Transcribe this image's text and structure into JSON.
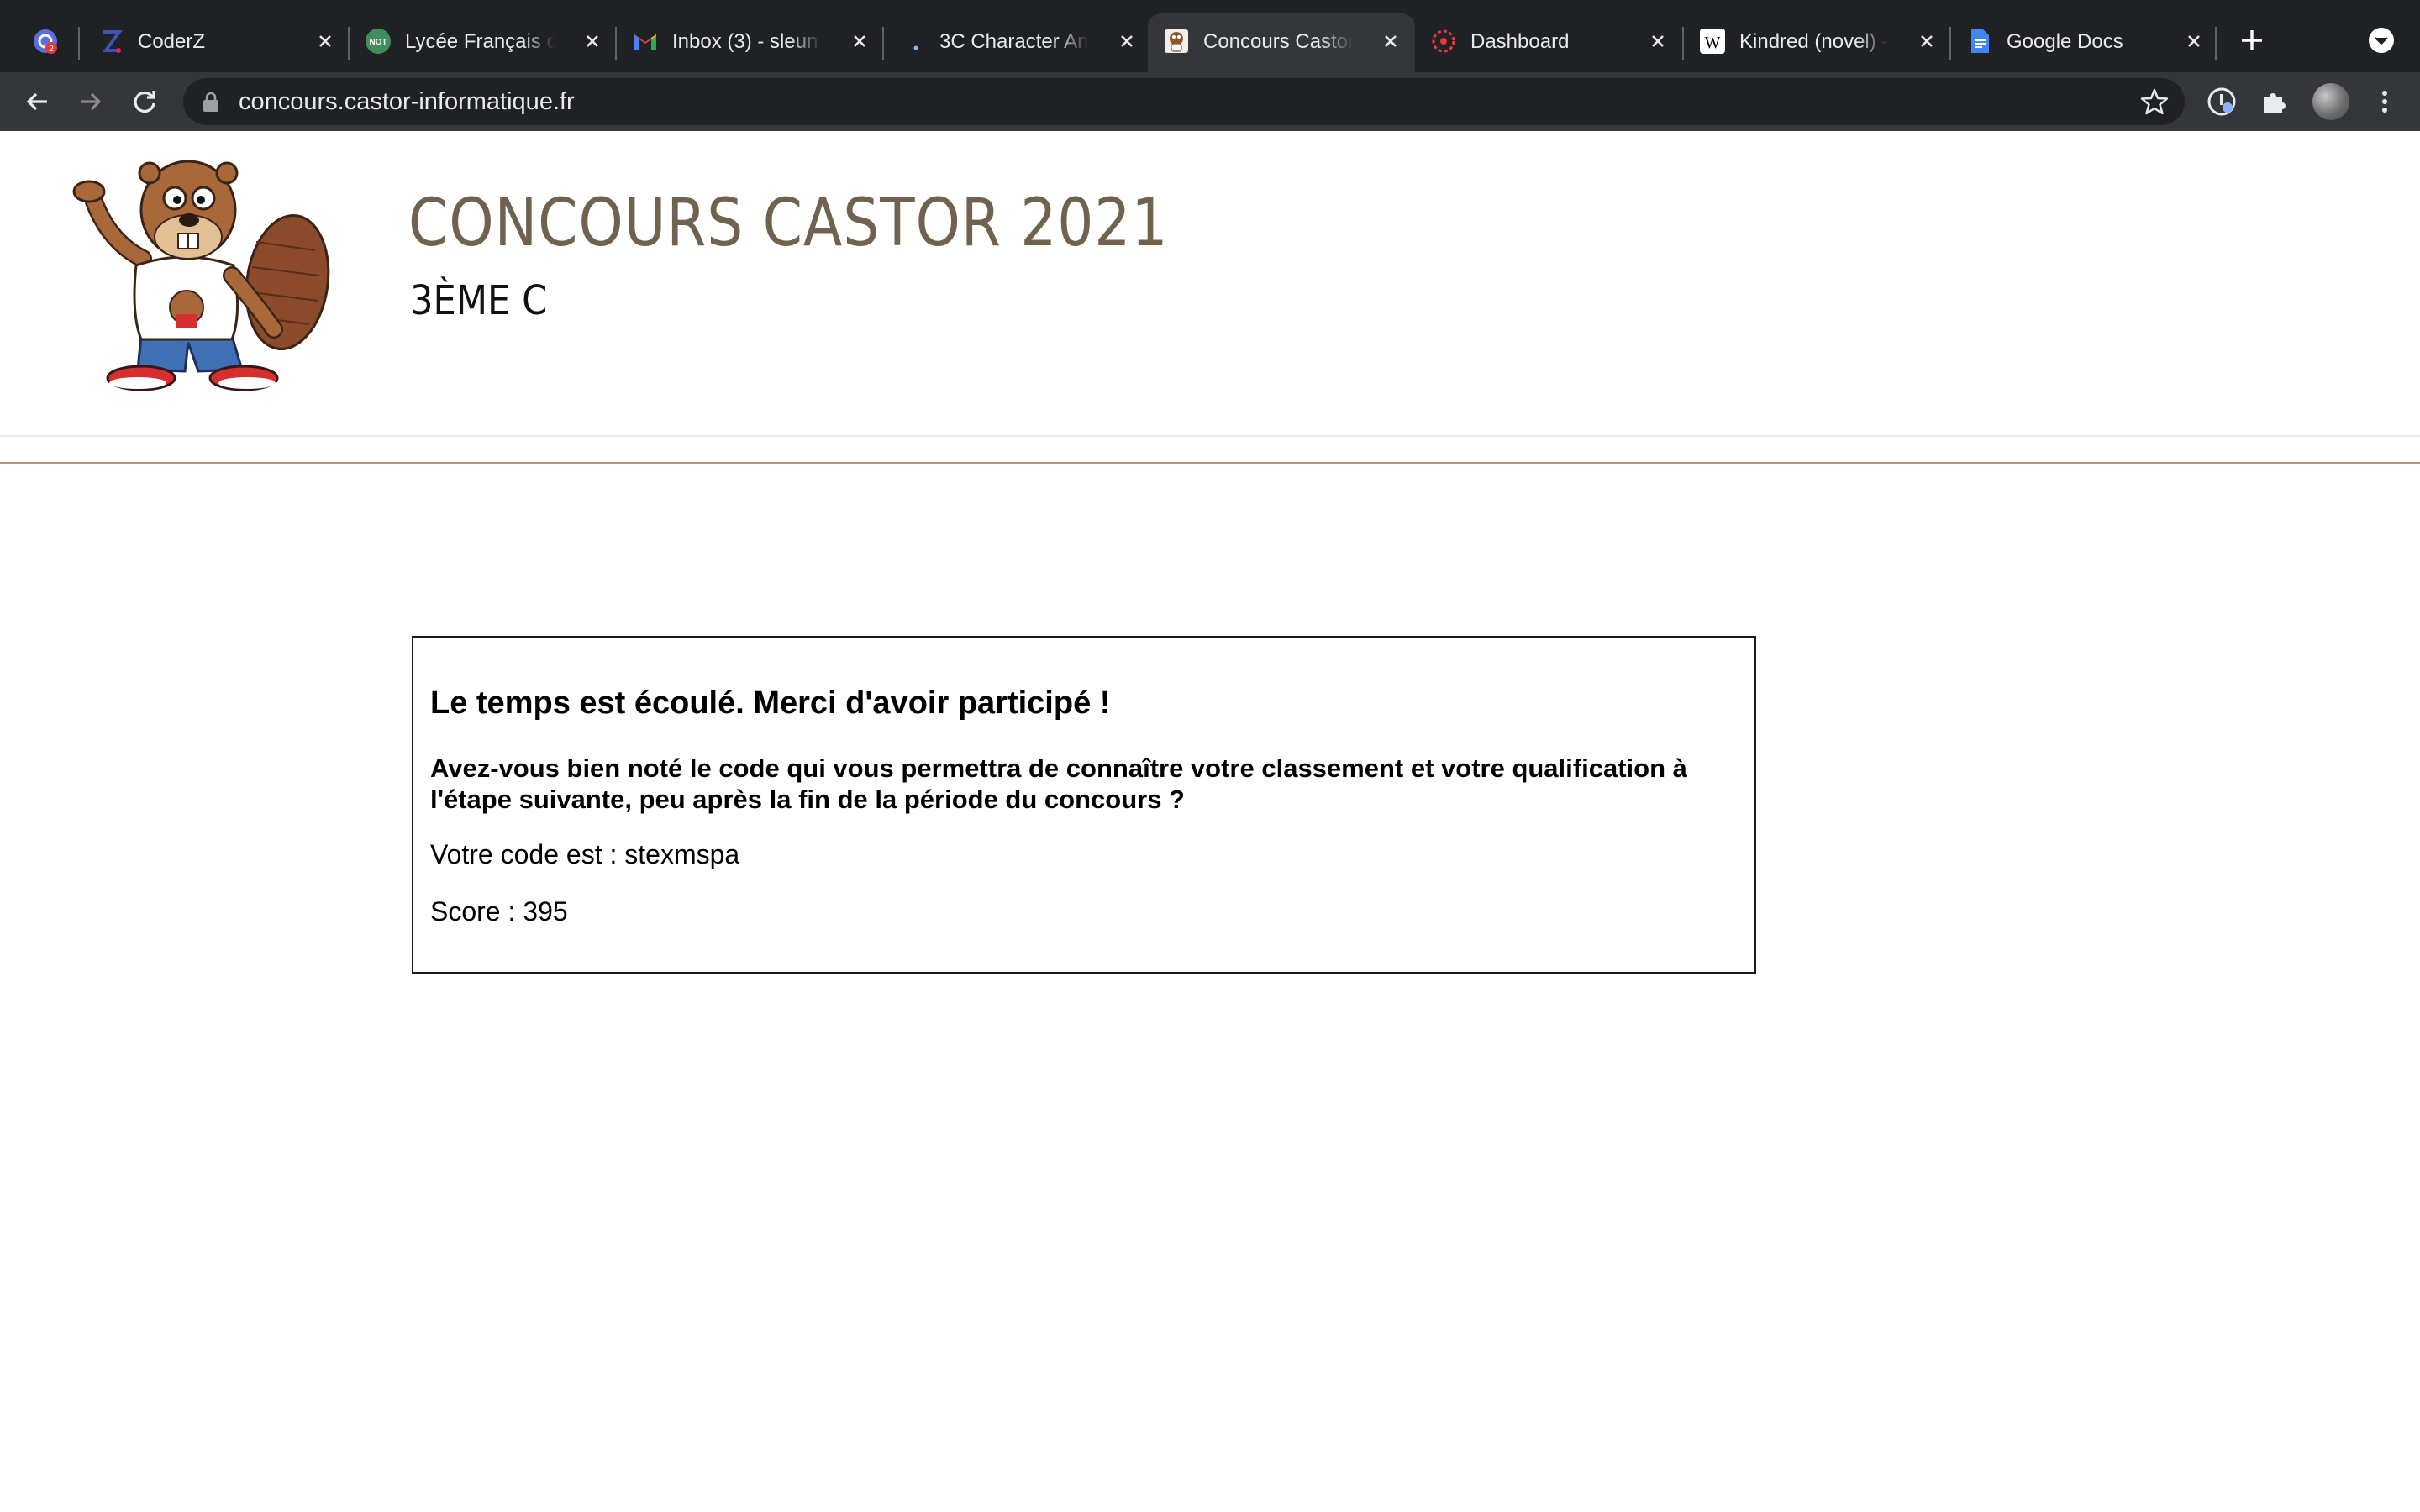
{
  "browser": {
    "tabs": [
      {
        "title": "",
        "icon": "extension-badge-icon"
      },
      {
        "title": "CoderZ",
        "icon": "coderz-icon"
      },
      {
        "title": "Lycée Français de",
        "icon": "not-badge-icon"
      },
      {
        "title": "Inbox (3) - sleun",
        "icon": "gmail-icon"
      },
      {
        "title": "3C Character An",
        "icon": "dot-icon"
      },
      {
        "title": "Concours Castor",
        "icon": "castor-favicon-icon",
        "active": true
      },
      {
        "title": "Dashboard",
        "icon": "dashboard-icon"
      },
      {
        "title": "Kindred (novel) -",
        "icon": "wikipedia-icon"
      },
      {
        "title": "Google Docs",
        "icon": "google-docs-icon"
      }
    ],
    "address_bar": {
      "url": "concours.castor-informatique.fr"
    }
  },
  "header": {
    "title": "CONCOURS CASTOR 2021",
    "subtitle": "3ÈME C",
    "title_color": "#6f6350"
  },
  "result": {
    "heading": "Le temps est écoulé. Merci d'avoir participé !",
    "question": "Avez-vous bien noté le code qui vous permettra de connaître votre classement et votre qualification à l'étape suivante, peu après la fin de la période du concours ?",
    "code_line": "Votre code est : stexmspa",
    "score_line": "Score : 395"
  }
}
